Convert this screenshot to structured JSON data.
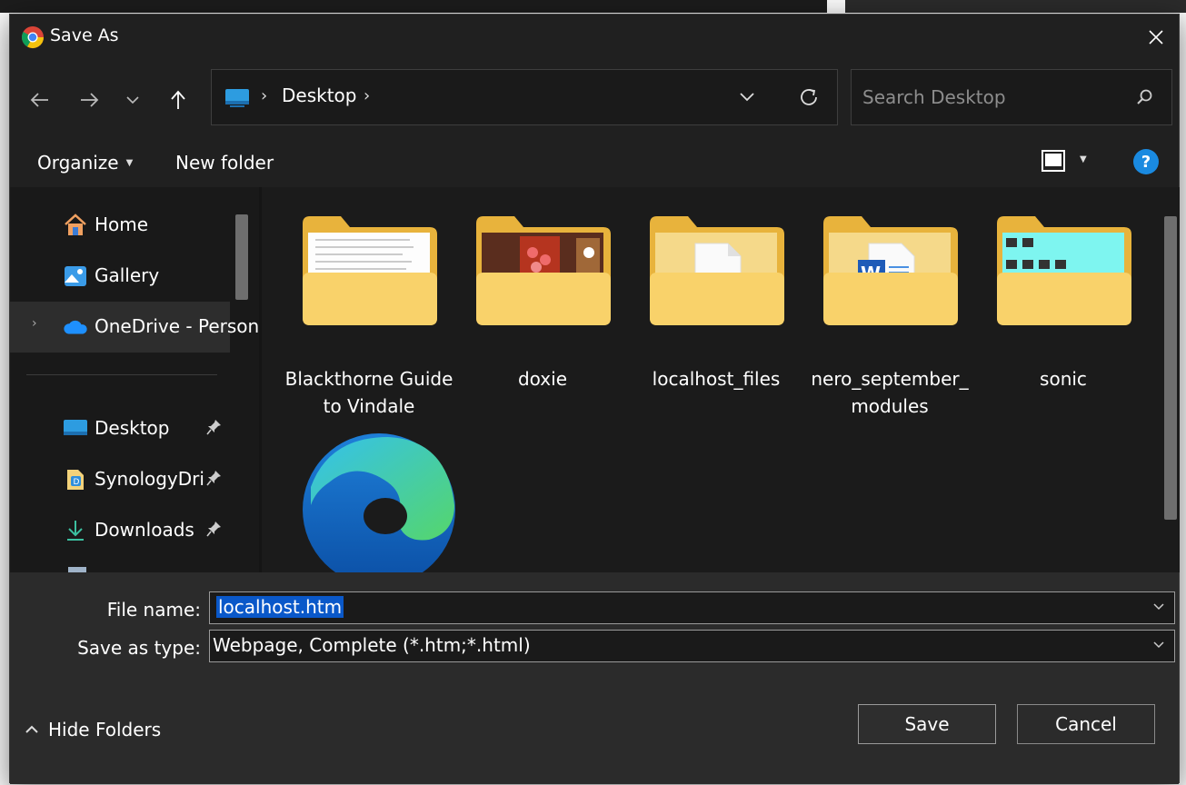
{
  "window": {
    "title": "Save As",
    "app_icon": "chrome-icon"
  },
  "address_bar": {
    "location_icon": "desktop-pc-icon",
    "path": [
      "Desktop"
    ]
  },
  "search": {
    "placeholder": "Search Desktop"
  },
  "toolbar": {
    "organize_label": "Organize",
    "new_folder_label": "New folder",
    "help_label": "?"
  },
  "sidebar": {
    "items": [
      {
        "label": "Home",
        "icon": "home-icon"
      },
      {
        "label": "Gallery",
        "icon": "gallery-icon"
      },
      {
        "label": "OneDrive - Personal",
        "icon": "onedrive-icon",
        "expandable": true,
        "selected": true
      },
      {
        "label": "Desktop",
        "icon": "desktop-icon",
        "pinned": true
      },
      {
        "label": "SynologyDrive",
        "icon": "synology-drive-icon",
        "pinned": true
      },
      {
        "label": "Downloads",
        "icon": "downloads-icon",
        "pinned": true
      }
    ]
  },
  "files": [
    {
      "name": "Blackthorne Guide to Vindale",
      "type": "folder",
      "preview": "document"
    },
    {
      "name": "doxie",
      "type": "folder",
      "preview": "image"
    },
    {
      "name": "localhost_files",
      "type": "folder",
      "preview": "blank-file"
    },
    {
      "name": "nero_september_ modules",
      "type": "folder",
      "preview": "word-doc"
    },
    {
      "name": "sonic",
      "type": "folder",
      "preview": "cyan-image"
    },
    {
      "name": "",
      "type": "shortcut",
      "icon": "edge-icon"
    }
  ],
  "form": {
    "file_name_label": "File name:",
    "file_name_value": "localhost.htm",
    "save_type_label": "Save as type:",
    "save_type_value": "Webpage, Complete (*.htm;*.html)"
  },
  "footer": {
    "hide_folders_label": "Hide Folders",
    "save_label": "Save",
    "cancel_label": "Cancel"
  },
  "colors": {
    "dialog_bg": "#202020",
    "accent": "#0a58c9",
    "folder": "#f5c842",
    "help": "#1a8ae0"
  }
}
